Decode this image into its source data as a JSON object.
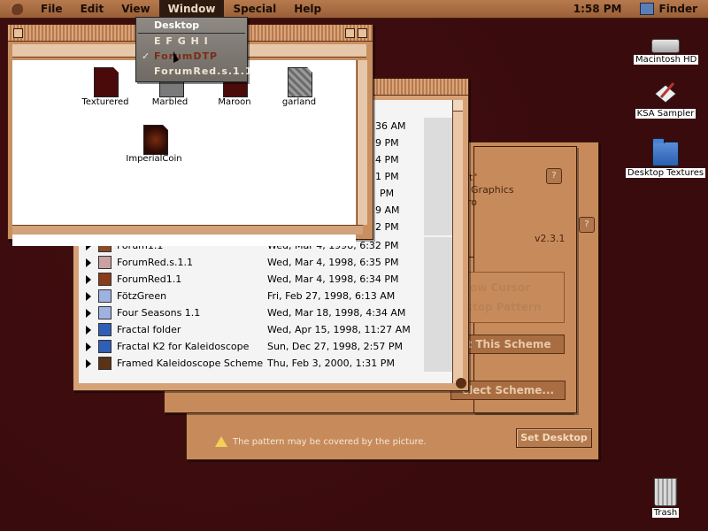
{
  "menubar": {
    "items": [
      "File",
      "Edit",
      "View",
      "Window",
      "Special",
      "Help"
    ],
    "active": "Window",
    "clock": "1:58 PM",
    "app": "Finder"
  },
  "window_menu": {
    "items": [
      "Desktop",
      "E F G H I",
      "ForumDTP",
      "ForumRed.s.1.1"
    ],
    "checked": "ForumDTP"
  },
  "desktop_icons": {
    "hd": "Macintosh HD",
    "ksa": "KSA Sampler",
    "textures": "Desktop Textures",
    "trash": "Trash"
  },
  "front_window": {
    "files": [
      {
        "name": "Texturered",
        "color": "#4a0a0a"
      },
      {
        "name": "Marbled",
        "color": "#7a7a7a"
      },
      {
        "name": "Maroon",
        "color": "#4b0b0b"
      },
      {
        "name": "garland",
        "color": "#8a8a8a"
      },
      {
        "name": "ImperialCoin",
        "color": "#3b1208"
      }
    ]
  },
  "list_window": {
    "partial_times": [
      "36 AM",
      "9 PM",
      "4 PM",
      "1 PM",
      "PM",
      "9 AM",
      "2 PM"
    ],
    "rows": [
      {
        "name": "Forum1.1",
        "date": "Wed, Mar 4, 1998, 6:32 PM"
      },
      {
        "name": "ForumRed.s.1.1",
        "date": "Wed, Mar 4, 1998, 6:35 PM"
      },
      {
        "name": "ForumRed1.1",
        "date": "Wed, Mar 4, 1998, 6:34 PM"
      },
      {
        "name": "FötzGreen",
        "date": "Fri, Feb 27, 1998, 6:13 AM"
      },
      {
        "name": "Four Seasons 1.1",
        "date": "Wed, Mar 18, 1998, 4:34 AM"
      },
      {
        "name": "Fractal  folder",
        "date": "Wed, Apr 15, 1998, 11:27 AM"
      },
      {
        "name": "Fractal K2  for Kaleidoscope",
        "date": "Sun, Dec 27, 1998, 2:57 PM"
      },
      {
        "name": "Framed Kaleidoscope Scheme",
        "date": "Thu, Feb 3, 2000, 1:31 PM"
      }
    ]
  },
  "dialog": {
    "graphics_text": "r Graphics",
    "ro_text": "ro",
    "version": "v2.3.1",
    "show_cursor": "ow Cursor",
    "desktop_pattern": "ktop Pattern",
    "apply_scheme": "t This Scheme",
    "select_scheme": "elect Scheme...",
    "warning": "The pattern may be covered by the picture.",
    "set_desktop": "Set Desktop"
  },
  "colors": {
    "desktop": "#3a0b0d",
    "accent": "#c98f60",
    "menu_highlight": "#2e1a0f"
  }
}
